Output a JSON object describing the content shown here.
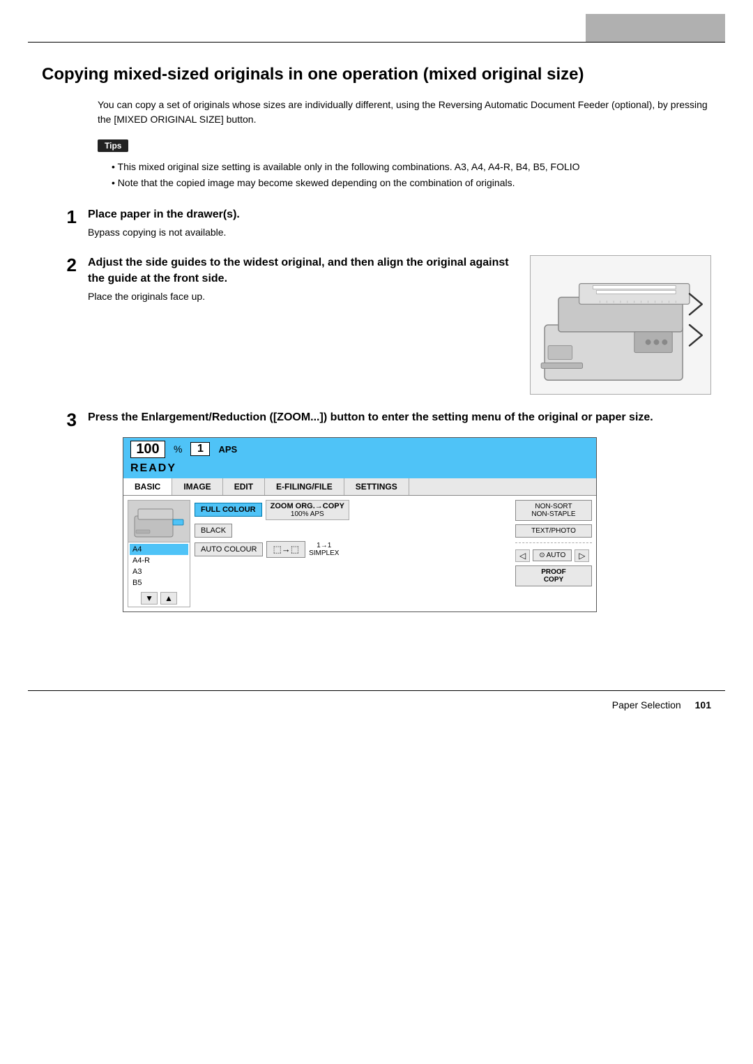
{
  "header": {
    "top_gray_box": ""
  },
  "page": {
    "title": "Copying mixed-sized originals in one operation (mixed original size)",
    "intro": "You can copy a set of originals whose sizes are individually different, using the Reversing Automatic Document Feeder (optional), by pressing the [MIXED ORIGINAL SIZE] button.",
    "tips_label": "Tips",
    "tips": [
      "This mixed original size setting is available only in the following combinations. A3, A4, A4-R, B4, B5, FOLIO",
      "Note that the copied image may become skewed depending on the combination of originals."
    ],
    "steps": [
      {
        "number": "1",
        "title": "Place paper in the drawer(s).",
        "desc": "Bypass copying is not available.",
        "has_image": false
      },
      {
        "number": "2",
        "title": "Adjust the side guides to the widest original, and then align the original against the guide at the front side.",
        "desc": "Place the originals face up.",
        "has_image": true
      },
      {
        "number": "3",
        "title": "Press the Enlargement/Reduction ([ZOOM...]) button to enter the setting menu of the original or paper size.",
        "desc": "",
        "has_image": false,
        "has_screen": true
      }
    ],
    "screen": {
      "percent": "100",
      "pct_sign": "%",
      "copies": "1",
      "aps_label": "APS",
      "ready_label": "READY",
      "tabs": [
        "BASIC",
        "IMAGE",
        "EDIT",
        "E-FILING/FILE",
        "SETTINGS"
      ],
      "active_tab": "BASIC",
      "paper_items": [
        "A4",
        "A4-R",
        "A3",
        "B5"
      ],
      "full_colour_label": "FULL COLOUR",
      "black_label": "BLACK",
      "auto_colour_label": "AUTO COLOUR",
      "zoom_top": "ZOOM  ORG.→COPY",
      "zoom_bottom": "100%       APS",
      "non_sort_label": "NON-SORT\nNON-STAPLE",
      "simplex_label": "SIMPLEX",
      "text_photo_label": "TEXT/PHOTO",
      "proof_copy_label": "PROOF\nCOPY",
      "auto_label": "AUTO"
    },
    "footer": {
      "section": "Paper Selection",
      "page_number": "101"
    }
  }
}
